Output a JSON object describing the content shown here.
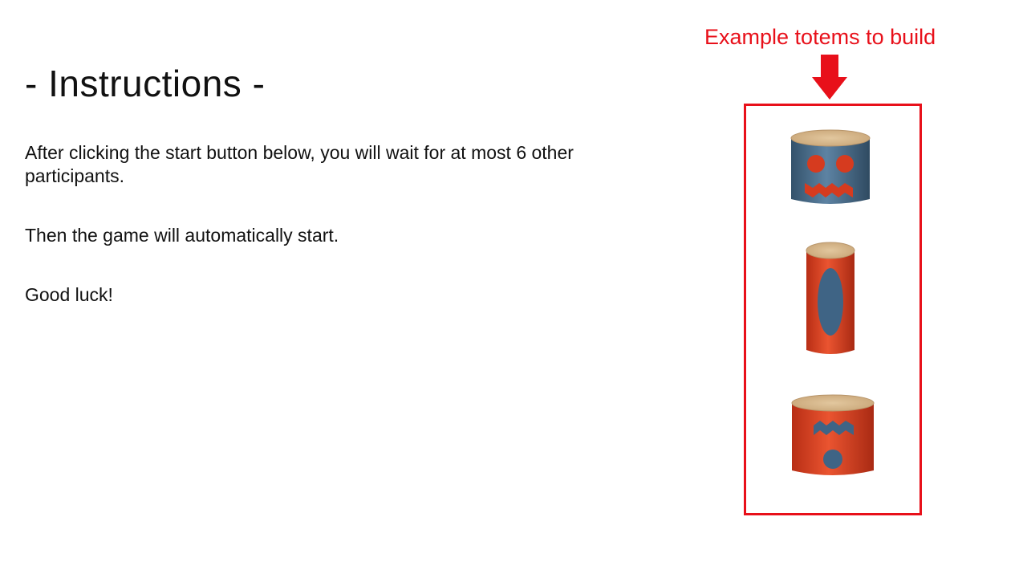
{
  "instructions": {
    "title": "- Instructions -",
    "paragraphs": [
      "After clicking the start button below, you will wait for at most 6 other participants.",
      "Then the game will automatically start.",
      "Good luck!"
    ]
  },
  "examples": {
    "label": "Example totems to build",
    "accent_color": "#e8101a",
    "totems": [
      {
        "name": "blue-totem-with-red-eyes-and-zigzag-mouth",
        "body_color": "#4a6f8e",
        "feature_color": "#d63b1f"
      },
      {
        "name": "red-tall-totem-with-blue-oval",
        "body_color": "#d63b1f",
        "feature_color": "#3f6485"
      },
      {
        "name": "red-totem-with-blue-zigzag-and-circle",
        "body_color": "#d63b1f",
        "feature_color": "#3f6485"
      }
    ]
  }
}
